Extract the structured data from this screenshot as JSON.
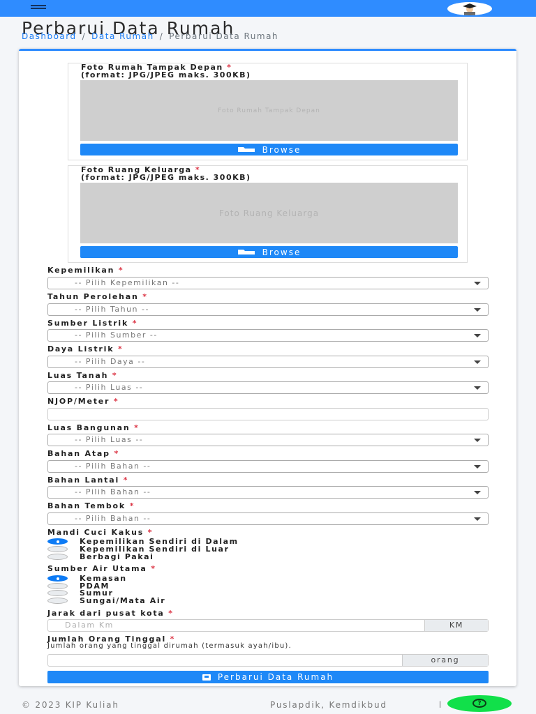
{
  "header": {
    "avatar_icon": "graduate-avatar-icon",
    "menu_icon": "hamburger-menu-icon"
  },
  "page": {
    "title": "Perbarui Data Rumah",
    "breadcrumb": [
      "Dashboard",
      "Data Rumah",
      "Perbarui Data Rumah"
    ]
  },
  "photos": [
    {
      "label": "Foto Rumah Tampak Depan",
      "format": "(format: JPG/JPEG maks. 300KB)",
      "placeholder": "Foto Rumah Tampak Depan",
      "button": "Browse"
    },
    {
      "label": "Foto Ruang Keluarga",
      "format": "(format: JPG/JPEG maks. 300KB)",
      "placeholder": "Foto Ruang Keluarga",
      "button": "Browse"
    }
  ],
  "required_mark": "*",
  "fields": {
    "kepemilikan": {
      "label": "Kepemilikan",
      "value": "-- Pilih Kepemilikan --"
    },
    "tahun": {
      "label": "Tahun Perolehan",
      "value": "-- Pilih Tahun --"
    },
    "sumber_listrik": {
      "label": "Sumber Listrik",
      "value": "-- Pilih Sumber --"
    },
    "daya_listrik": {
      "label": "Daya Listrik",
      "value": "-- Pilih Daya --"
    },
    "luas_tanah": {
      "label": "Luas Tanah",
      "value": "-- Pilih Luas --"
    },
    "njop": {
      "label": "NJOP/Meter",
      "value": ""
    },
    "luas_bangunan": {
      "label": "Luas Bangunan",
      "value": "-- Pilih Luas --"
    },
    "bahan_atap": {
      "label": "Bahan Atap",
      "value": "-- Pilih Bahan --"
    },
    "bahan_lantai": {
      "label": "Bahan Lantai",
      "value": "-- Pilih Bahan --"
    },
    "bahan_tembok": {
      "label": "Bahan Tembok",
      "value": "-- Pilih Bahan --"
    }
  },
  "mck": {
    "label": "Mandi Cuci Kakus",
    "options": [
      {
        "label": "Kepemilikan Sendiri di Dalam",
        "checked": true
      },
      {
        "label": "Kepemilikan Sendiri di Luar",
        "checked": false
      },
      {
        "label": "Berbagi Pakai",
        "checked": false
      }
    ]
  },
  "air": {
    "label": "Sumber Air Utama",
    "options": [
      {
        "label": "Kemasan",
        "checked": true
      },
      {
        "label": "PDAM",
        "checked": false
      },
      {
        "label": "Sumur",
        "checked": false
      },
      {
        "label": "Sungai/Mata Air",
        "checked": false
      }
    ]
  },
  "jarak": {
    "label": "Jarak dari pusat kota",
    "placeholder": "Dalam Km",
    "addon": "KM"
  },
  "jumlah": {
    "label": "Jumlah Orang Tinggal",
    "help": "Jumlah orang yang tinggal dirumah (termasuk ayah/ibu).",
    "addon": "orang"
  },
  "submit": {
    "label": "Perbarui Data Rumah"
  },
  "footer": {
    "left": "© 2023 KIP Kuliah",
    "right": "Puslapdik, Kemdikbud",
    "right_tail": "l",
    "help_icon": "question-icon",
    "help_label": "?"
  },
  "colors": {
    "primary": "#1e88f7",
    "topbar": "#2f8cff",
    "required": "#dc3545",
    "help_fab": "#11e04a"
  }
}
